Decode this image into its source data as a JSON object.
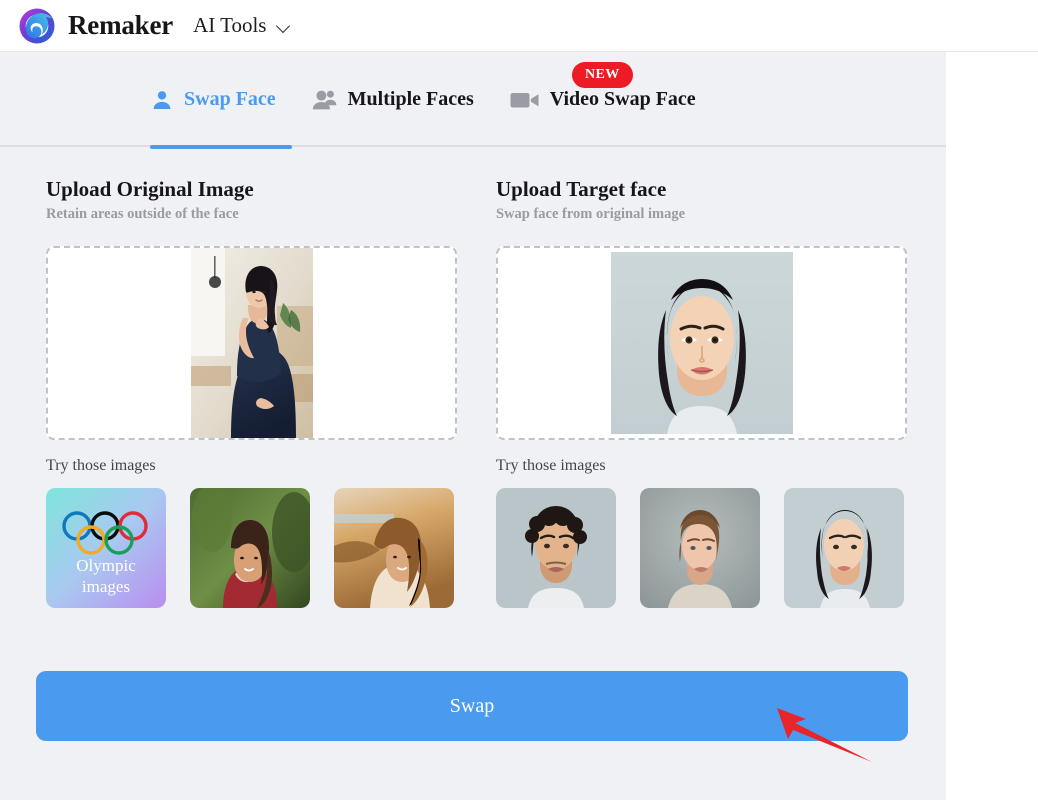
{
  "header": {
    "logo_icon": "remaker-swirl-logo",
    "brand": "Remaker",
    "menu_label": "AI Tools",
    "chevron_icon": "chevron-down-icon"
  },
  "tabs": [
    {
      "id": "swap-face",
      "label": "Swap Face",
      "icon": "person-icon",
      "active": true,
      "badge": ""
    },
    {
      "id": "multiple-faces",
      "label": "Multiple Faces",
      "icon": "people-icon",
      "active": false,
      "badge": ""
    },
    {
      "id": "video-swap-face",
      "label": "Video Swap Face",
      "icon": "video-camera-icon",
      "active": false,
      "badge": "NEW"
    }
  ],
  "badge": {
    "new_label": "NEW"
  },
  "panels": {
    "left": {
      "title": "Upload Original Image",
      "subtitle": "Retain areas outside of the face",
      "dropzone_image": "pregnant-woman-navy-dress-photo",
      "try_label": "Try those images",
      "thumbs": [
        {
          "name": "olympic-images-tile",
          "caption_line1": "Olympic",
          "caption_line2": "images"
        },
        {
          "name": "woman-red-top-forest-photo",
          "caption_line1": "",
          "caption_line2": ""
        },
        {
          "name": "woman-beach-sunset-photo",
          "caption_line1": "",
          "caption_line2": ""
        }
      ]
    },
    "right": {
      "title": "Upload Target face",
      "subtitle": "Swap face from original image",
      "dropzone_image": "asian-woman-portrait-photo",
      "try_label": "Try those images",
      "thumbs": [
        {
          "name": "curly-hair-man-portrait-photo"
        },
        {
          "name": "young-woman-grey-sweater-photo"
        },
        {
          "name": "asian-woman-portrait-photo"
        }
      ]
    }
  },
  "actions": {
    "swap_label": "Swap"
  },
  "annotation": {
    "arrow": "red-arrow-pointing-to-swap-button"
  },
  "colors": {
    "accent": "#4a9bf0",
    "badge_red": "#ed1c24",
    "panel_bg": "#f0f1f5",
    "header_bg": "#ffffff",
    "text": "#16161a",
    "muted": "#9a9aa3",
    "dashed_border": "#bfc2c9"
  }
}
